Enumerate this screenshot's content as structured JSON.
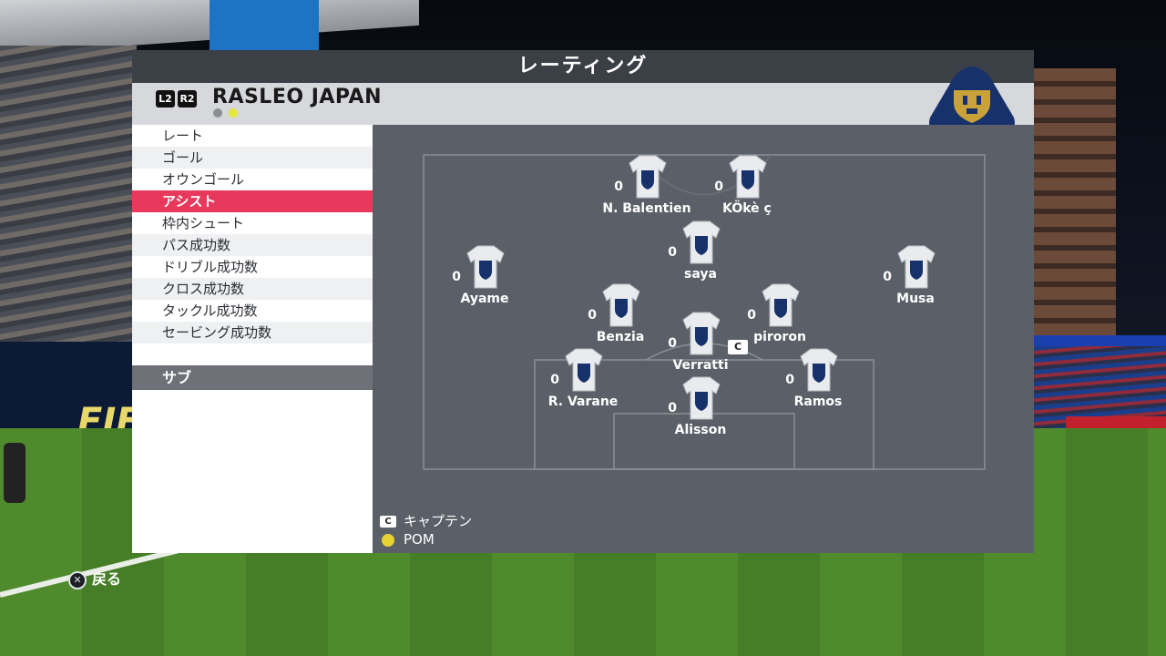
{
  "screen_title": "レーティング",
  "team": {
    "name": "RASLEO JAPAN",
    "l2_label": "L2",
    "r2_label": "R2",
    "crest_icon": "pumas-crest-icon"
  },
  "stat_categories": [
    {
      "label": "レート",
      "selected": false
    },
    {
      "label": "ゴール",
      "selected": false
    },
    {
      "label": "オウンゴール",
      "selected": false
    },
    {
      "label": "アシスト",
      "selected": true
    },
    {
      "label": "枠内シュート",
      "selected": false
    },
    {
      "label": "パス成功数",
      "selected": false
    },
    {
      "label": "ドリブル成功数",
      "selected": false
    },
    {
      "label": "クロス成功数",
      "selected": false
    },
    {
      "label": "タックル成功数",
      "selected": false
    },
    {
      "label": "セービング成功数",
      "selected": false
    }
  ],
  "subs_label": "サブ",
  "players": [
    {
      "name": "N. Balentien",
      "value": "0",
      "captain": false
    },
    {
      "name": "KÖkè ç",
      "value": "0",
      "captain": false
    },
    {
      "name": "saya",
      "value": "0",
      "captain": false
    },
    {
      "name": "Ayame",
      "value": "0",
      "captain": false
    },
    {
      "name": "Musa",
      "value": "0",
      "captain": false
    },
    {
      "name": "Benzia",
      "value": "0",
      "captain": false
    },
    {
      "name": "piroron",
      "value": "0",
      "captain": false
    },
    {
      "name": "Verratti",
      "value": "0",
      "captain": true
    },
    {
      "name": "R. Varane",
      "value": "0",
      "captain": false
    },
    {
      "name": "Ramos",
      "value": "0",
      "captain": false
    },
    {
      "name": "Alisson",
      "value": "0",
      "captain": false
    }
  ],
  "captain_badge": "C",
  "legend": {
    "captain_label": "キャプテン",
    "captain_badge": "C",
    "pom_label": "POM"
  },
  "back_label": "戻る",
  "back_button_icon": "cross-button-icon",
  "colors": {
    "selected": "#e8395c",
    "pom": "#e6d230"
  }
}
